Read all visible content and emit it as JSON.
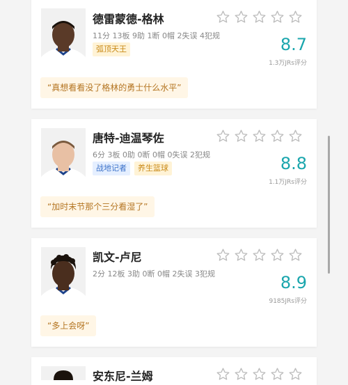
{
  "players": [
    {
      "name": "德雷蒙德-格林",
      "stats": "11分 13板 9助 1断 0帽 2失误 4犯规",
      "tags": [
        {
          "label": "弧顶天王",
          "color": "yellow"
        }
      ],
      "score": "8.7",
      "count": "1.3万JRs评分",
      "quote": "“真想看看没了格林的勇士什么水平”",
      "skin": "#5a3a28",
      "hair": "#1a120c"
    },
    {
      "name": "唐特-迪温琴佐",
      "stats": "6分 3板 0助 0断 0帽 0失误 2犯规",
      "tags": [
        {
          "label": "战地记者",
          "color": "blue"
        },
        {
          "label": "养生篮球",
          "color": "yellow"
        }
      ],
      "score": "8.8",
      "count": "1.1万JRs评分",
      "quote": "“加时末节那个三分看湿了”",
      "skin": "#e8c0a4",
      "hair": "#7a5a3e"
    },
    {
      "name": "凯文-卢尼",
      "stats": "2分 12板 3助 0断 0帽 2失误 3犯规",
      "tags": [],
      "score": "8.9",
      "count": "9185JRs评分",
      "quote": "“多上会呀”",
      "skin": "#4a2e1e",
      "hair": "#1a120c"
    },
    {
      "name": "安东尼-兰姆"
    }
  ],
  "colors": {
    "score": "#1aa6ad",
    "jersey": "#ffffff",
    "jersey_trim": "#1d428a"
  }
}
